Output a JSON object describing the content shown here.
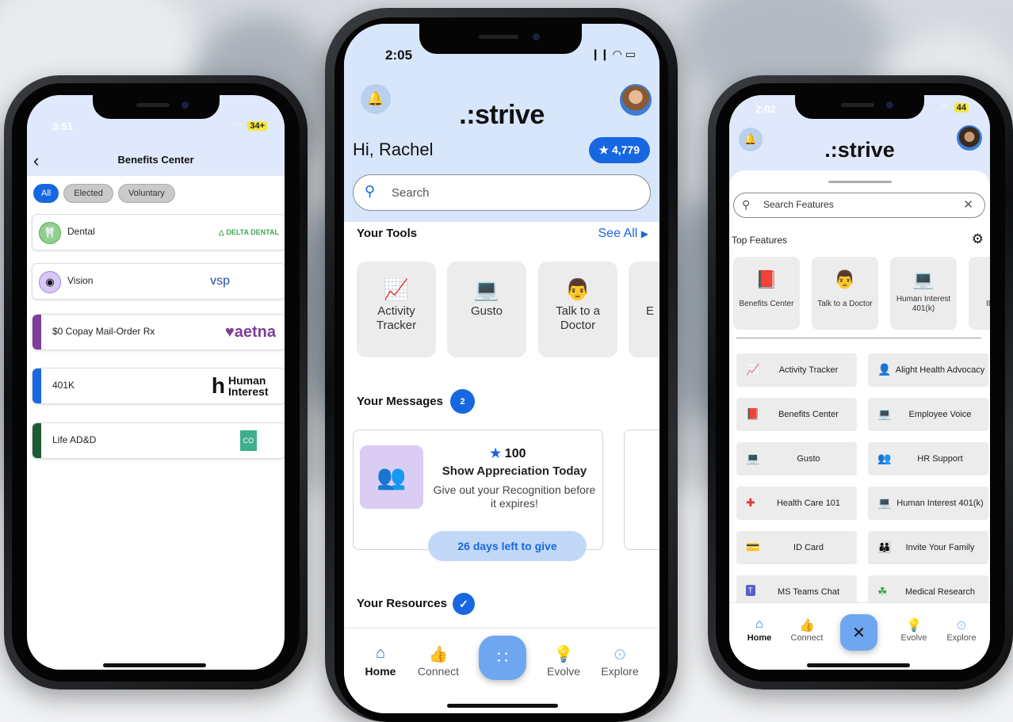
{
  "left_phone": {
    "status_time": "3:51",
    "battery": "34+",
    "back_icon": "chevron-left-icon",
    "title": "Benefits Center",
    "filters": [
      "All",
      "Elected",
      "Voluntary"
    ],
    "benefits": [
      {
        "label": "Dental",
        "logo": "△ DELTA DENTAL",
        "icon": "tooth-icon",
        "accent": "#7ec27a"
      },
      {
        "label": "Vision",
        "logo": "vsp",
        "icon": "eye-icon",
        "accent": "#c9b6ef"
      },
      {
        "label": "$0 Copay Mail-Order Rx",
        "logo": "♥aetna",
        "accent": "#7d3f98"
      },
      {
        "label": "401K",
        "logo": "Human Interest",
        "logo_mark": "h",
        "accent": "#1768e0"
      },
      {
        "label": "Life AD&D",
        "logo": "CO",
        "accent": "#1e5a34"
      }
    ]
  },
  "center_phone": {
    "status_time": "2:05",
    "logo": ".:strive",
    "greeting": "Hi, Rachel",
    "points": "4,779",
    "search_placeholder": "Search",
    "tools_heading": "Your Tools",
    "see_all": "See All",
    "tools": [
      {
        "label": "Activity Tracker",
        "icon": "activity-tracker-icon"
      },
      {
        "label": "Gusto",
        "icon": "laptop-icon"
      },
      {
        "label": "Talk to a Doctor",
        "icon": "doctor-icon"
      },
      {
        "label": "E",
        "icon": "partial-tool-icon"
      }
    ],
    "messages_heading": "Your Messages",
    "messages_count": "2",
    "message": {
      "points": "100",
      "title": "Show Appreciation Today",
      "body": "Give out your Recognition before it expires!",
      "button": "26 days left to give"
    },
    "resources_heading": "Your Resources",
    "nav": [
      "Home",
      "Connect",
      "Evolve",
      "Explore"
    ]
  },
  "right_phone": {
    "status_time": "2:02",
    "battery": "44",
    "logo": ".:strive",
    "search_placeholder": "Search Features",
    "top_features_heading": "Top Features",
    "top_features": [
      {
        "label": "Benefits Center",
        "icon": "book-icon"
      },
      {
        "label": "Talk to a Doctor",
        "icon": "doctor-icon"
      },
      {
        "label": "Human Interest 401(k)",
        "icon": "laptop-icon"
      },
      {
        "label": "ID",
        "icon": "partial-icon"
      }
    ],
    "features": [
      {
        "label": "Activity Tracker",
        "icon": "activity-tracker-icon"
      },
      {
        "label": "Alight Health Advocacy",
        "icon": "person-icon"
      },
      {
        "label": "Benefits Center",
        "icon": "book-icon"
      },
      {
        "label": "Employee Voice",
        "icon": "laptop-icon"
      },
      {
        "label": "Gusto",
        "icon": "laptop-icon"
      },
      {
        "label": "HR Support",
        "icon": "people-icon"
      },
      {
        "label": "Health Care 101",
        "icon": "first-aid-icon"
      },
      {
        "label": "Human Interest 401(k)",
        "icon": "laptop-icon"
      },
      {
        "label": "ID Card",
        "icon": "id-card-icon"
      },
      {
        "label": "Invite Your Family",
        "icon": "family-icon"
      },
      {
        "label": "MS Teams Chat",
        "icon": "teams-icon"
      },
      {
        "label": "Medical Research",
        "icon": "puzzle-icon"
      }
    ],
    "nav": [
      "Home",
      "Connect",
      "Evolve",
      "Explore"
    ]
  }
}
